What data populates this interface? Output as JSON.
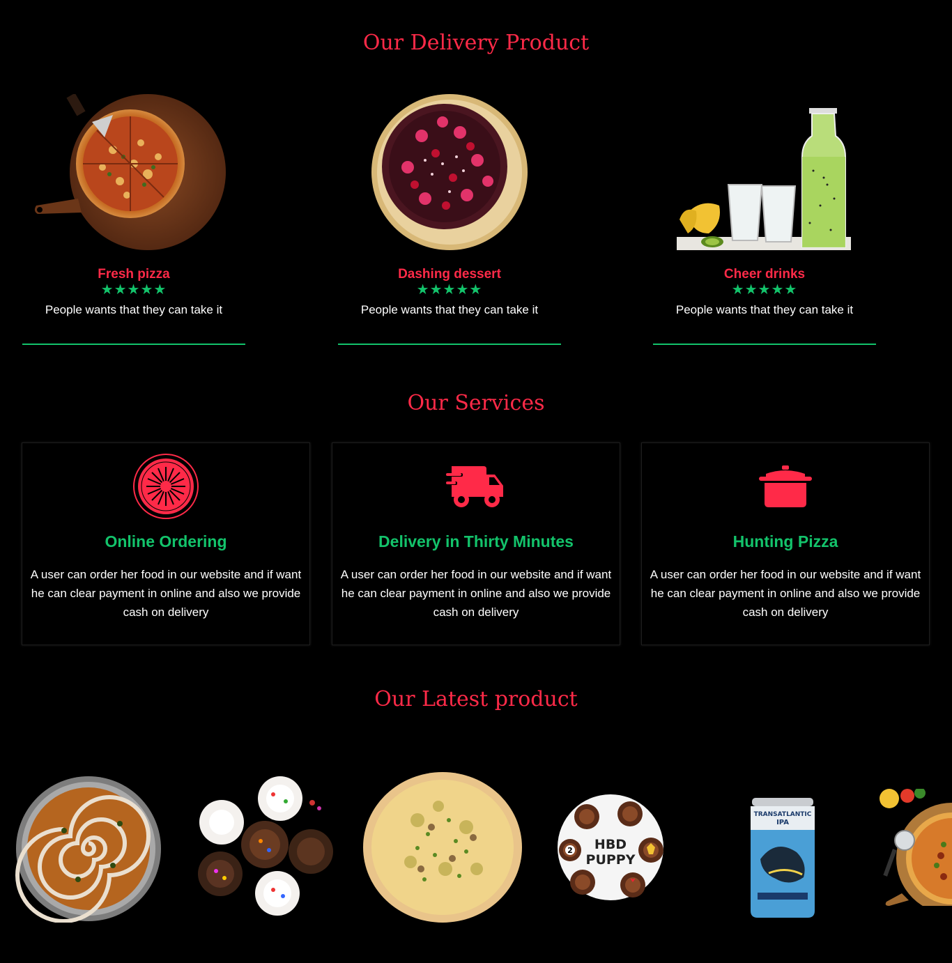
{
  "sections": {
    "delivery_title": "Our Delivery Product",
    "services_title": "Our Services",
    "latest_title": "Our Latest product"
  },
  "products": [
    {
      "name": "Fresh pizza",
      "stars": "★★★★★",
      "rating": 5,
      "desc": "People wants that they can take it"
    },
    {
      "name": "Dashing dessert",
      "stars": "★★★★★",
      "rating": 5,
      "desc": "People wants that they can take it"
    },
    {
      "name": "Cheer drinks",
      "stars": "★★★★★",
      "rating": 5,
      "desc": "People wants that they can take it"
    }
  ],
  "services": [
    {
      "icon": "dish-icon",
      "title": "Online Ordering",
      "text": "A user can order her food in our website and if want he can clear payment in online and also we provide cash on delivery"
    },
    {
      "icon": "truck-icon",
      "title": "Delivery in Thirty Minutes",
      "text": "A user can order her food in our website and if want he can clear payment in online and also we provide cash on delivery"
    },
    {
      "icon": "pot-icon",
      "title": "Hunting Pizza",
      "text": "A user can order her food in our website and if want he can clear payment in online and also we provide cash on delivery"
    }
  ],
  "latest_products": [
    {
      "icon": "pizza-spiral-image"
    },
    {
      "icon": "cupcakes-image"
    },
    {
      "icon": "pizza-image"
    },
    {
      "icon": "birthday-cupcakes-image",
      "label_line1": "HBD",
      "label_line2": "PUPPY",
      "badge": "2"
    },
    {
      "icon": "beer-can-image",
      "label_line1": "TRANSATLANTIC",
      "label_line2": "IPA"
    },
    {
      "icon": "pizza-board-image"
    }
  ],
  "colors": {
    "accent": "#ff2a48",
    "green": "#13c36b",
    "background": "#000000"
  }
}
